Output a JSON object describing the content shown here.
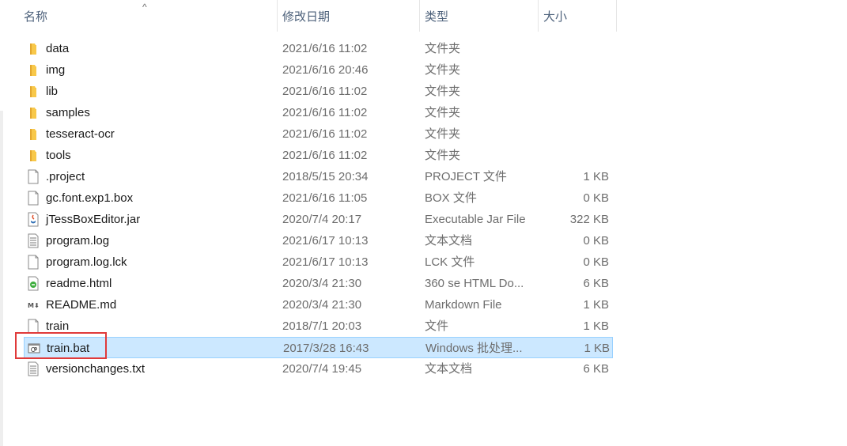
{
  "columns": {
    "name": "名称",
    "date": "修改日期",
    "type": "类型",
    "size": "大小"
  },
  "sort_indicator": "^",
  "files": [
    {
      "name": "data",
      "date": "2021/6/16 11:02",
      "type": "文件夹",
      "size": "",
      "icon": "folder-icon"
    },
    {
      "name": "img",
      "date": "2021/6/16 20:46",
      "type": "文件夹",
      "size": "",
      "icon": "folder-icon"
    },
    {
      "name": "lib",
      "date": "2021/6/16 11:02",
      "type": "文件夹",
      "size": "",
      "icon": "folder-icon"
    },
    {
      "name": "samples",
      "date": "2021/6/16 11:02",
      "type": "文件夹",
      "size": "",
      "icon": "folder-icon"
    },
    {
      "name": "tesseract-ocr",
      "date": "2021/6/16 11:02",
      "type": "文件夹",
      "size": "",
      "icon": "folder-icon"
    },
    {
      "name": "tools",
      "date": "2021/6/16 11:02",
      "type": "文件夹",
      "size": "",
      "icon": "folder-icon"
    },
    {
      "name": ".project",
      "date": "2018/5/15 20:34",
      "type": "PROJECT 文件",
      "size": "1 KB",
      "icon": "blank-file-icon"
    },
    {
      "name": "gc.font.exp1.box",
      "date": "2021/6/16 11:05",
      "type": "BOX 文件",
      "size": "0 KB",
      "icon": "blank-file-icon"
    },
    {
      "name": "jTessBoxEditor.jar",
      "date": "2020/7/4 20:17",
      "type": "Executable Jar File",
      "size": "322 KB",
      "icon": "java-jar-icon"
    },
    {
      "name": "program.log",
      "date": "2021/6/17 10:13",
      "type": "文本文档",
      "size": "0 KB",
      "icon": "text-file-icon"
    },
    {
      "name": "program.log.lck",
      "date": "2021/6/17 10:13",
      "type": "LCK 文件",
      "size": "0 KB",
      "icon": "blank-file-icon"
    },
    {
      "name": "readme.html",
      "date": "2020/3/4 21:30",
      "type": "360 se HTML Do...",
      "size": "6 KB",
      "icon": "html-file-icon"
    },
    {
      "name": "README.md",
      "date": "2020/3/4 21:30",
      "type": "Markdown File",
      "size": "1 KB",
      "icon": "markdown-file-icon"
    },
    {
      "name": "train",
      "date": "2018/7/1 20:03",
      "type": "文件",
      "size": "1 KB",
      "icon": "blank-file-icon"
    },
    {
      "name": "train.bat",
      "date": "2017/3/28 16:43",
      "type": "Windows 批处理...",
      "size": "1 KB",
      "icon": "batch-file-icon",
      "selected": true
    },
    {
      "name": "versionchanges.txt",
      "date": "2020/7/4 19:45",
      "type": "文本文档",
      "size": "6 KB",
      "icon": "text-file-icon"
    }
  ],
  "colors": {
    "selection_bg": "#cce8ff",
    "selection_border": "#99d1ff",
    "annotation_box": "#e03a3a",
    "folder": "#f8c84a"
  }
}
